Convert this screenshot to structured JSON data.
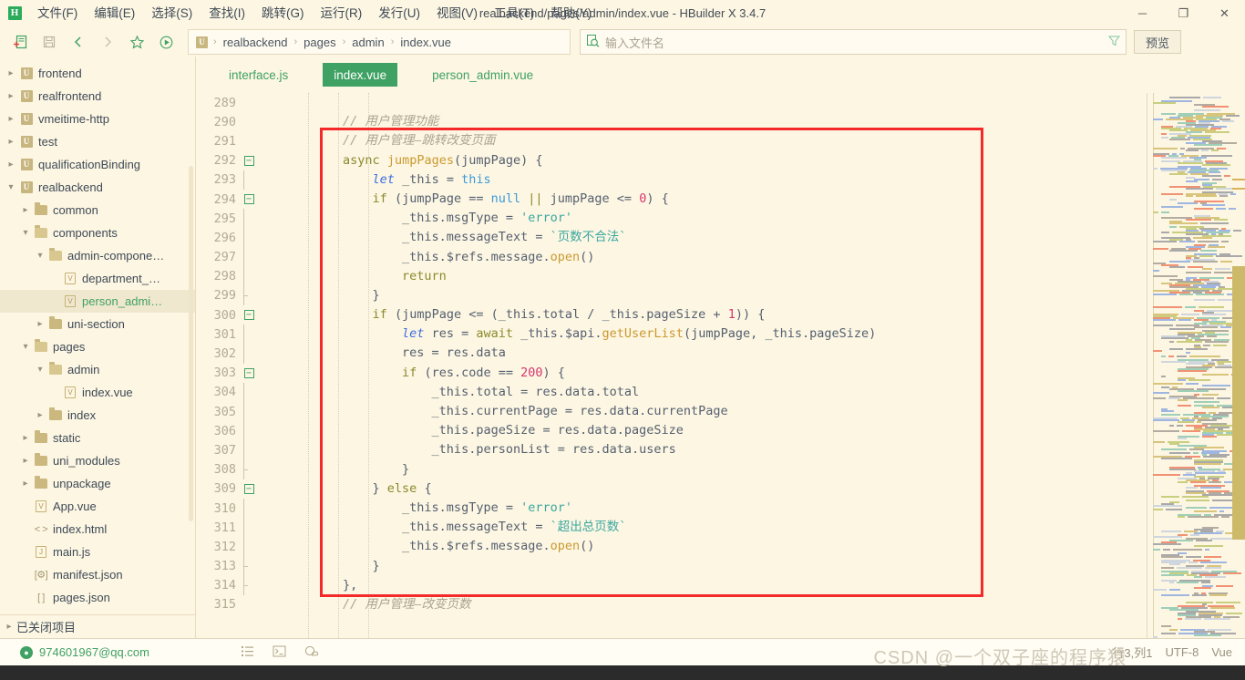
{
  "window": {
    "title": "realbackend/pages/admin/index.vue - HBuilder X 3.4.7",
    "logo": "H",
    "minimize": "─",
    "maximize": "❐",
    "close": "✕"
  },
  "menubar": {
    "items": [
      {
        "label": "文件(F)",
        "name": "menu-file"
      },
      {
        "label": "编辑(E)",
        "name": "menu-edit"
      },
      {
        "label": "选择(S)",
        "name": "menu-select"
      },
      {
        "label": "查找(I)",
        "name": "menu-find"
      },
      {
        "label": "跳转(G)",
        "name": "menu-goto"
      },
      {
        "label": "运行(R)",
        "name": "menu-run"
      },
      {
        "label": "发行(U)",
        "name": "menu-publish"
      },
      {
        "label": "视图(V)",
        "name": "menu-view"
      },
      {
        "label": "工具(T)",
        "name": "menu-tools"
      },
      {
        "label": "帮助(Y)",
        "name": "menu-help"
      }
    ]
  },
  "toolbar": {
    "new_file_icon": "new-file-icon",
    "save_icon": "save-icon",
    "back_icon": "back-arrow-icon",
    "forward_icon": "forward-arrow-icon",
    "favorite_icon": "star-icon",
    "run_icon": "run-play-icon",
    "breadcrumb": {
      "project_badge": "U",
      "items": [
        "realbackend",
        "pages",
        "admin",
        "index.vue"
      ],
      "separator": "›"
    },
    "search": {
      "icon": "file-search-icon",
      "placeholder": "输入文件名",
      "value": "",
      "filter_icon": "filter-icon"
    },
    "preview_label": "预览"
  },
  "sidebar": {
    "tree": [
      {
        "label": "frontend",
        "depth": 0,
        "arrow": "collapsed",
        "icon": "uniapp-project-icon",
        "selected": false
      },
      {
        "label": "realfrontend",
        "depth": 0,
        "arrow": "collapsed",
        "icon": "uniapp-project-icon",
        "selected": false
      },
      {
        "label": "vmeitime-http",
        "depth": 0,
        "arrow": "collapsed",
        "icon": "uniapp-project-icon",
        "selected": false
      },
      {
        "label": "test",
        "depth": 0,
        "arrow": "collapsed",
        "icon": "uniapp-project-icon",
        "selected": false
      },
      {
        "label": "qualificationBinding",
        "depth": 0,
        "arrow": "collapsed",
        "icon": "uniapp-project-icon",
        "selected": false
      },
      {
        "label": "realbackend",
        "depth": 0,
        "arrow": "expanded",
        "icon": "uniapp-project-icon",
        "selected": false
      },
      {
        "label": "common",
        "depth": 1,
        "arrow": "collapsed",
        "icon": "folder-icon",
        "selected": false
      },
      {
        "label": "components",
        "depth": 1,
        "arrow": "expanded",
        "icon": "folder-open-icon",
        "selected": false
      },
      {
        "label": "admin-compone…",
        "depth": 2,
        "arrow": "expanded",
        "icon": "folder-open-icon",
        "selected": false
      },
      {
        "label": "department_…",
        "depth": 3,
        "arrow": "none",
        "icon": "vue-file-icon",
        "selected": false
      },
      {
        "label": "person_admi…",
        "depth": 3,
        "arrow": "none",
        "icon": "vue-file-icon",
        "selected": true
      },
      {
        "label": "uni-section",
        "depth": 2,
        "arrow": "collapsed",
        "icon": "folder-icon",
        "selected": false
      },
      {
        "label": "pages",
        "depth": 1,
        "arrow": "expanded",
        "icon": "folder-open-icon",
        "selected": false
      },
      {
        "label": "admin",
        "depth": 2,
        "arrow": "expanded",
        "icon": "folder-open-icon",
        "selected": false
      },
      {
        "label": "index.vue",
        "depth": 3,
        "arrow": "none",
        "icon": "vue-file-icon",
        "selected": false
      },
      {
        "label": "index",
        "depth": 2,
        "arrow": "collapsed",
        "icon": "folder-icon",
        "selected": false
      },
      {
        "label": "static",
        "depth": 1,
        "arrow": "collapsed",
        "icon": "folder-icon",
        "selected": false
      },
      {
        "label": "uni_modules",
        "depth": 1,
        "arrow": "collapsed",
        "icon": "folder-icon",
        "selected": false
      },
      {
        "label": "unpackage",
        "depth": 1,
        "arrow": "collapsed",
        "icon": "folder-icon",
        "selected": false
      },
      {
        "label": "App.vue",
        "depth": 1,
        "arrow": "none",
        "icon": "vue-file-icon",
        "selected": false
      },
      {
        "label": "index.html",
        "depth": 1,
        "arrow": "none",
        "icon": "html-file-icon",
        "selected": false
      },
      {
        "label": "main.js",
        "depth": 1,
        "arrow": "none",
        "icon": "js-file-icon",
        "selected": false
      },
      {
        "label": "manifest.json",
        "depth": 1,
        "arrow": "none",
        "icon": "manifest-file-icon",
        "selected": false
      },
      {
        "label": "pages.json",
        "depth": 1,
        "arrow": "none",
        "icon": "json-file-icon",
        "selected": false
      }
    ],
    "closed_projects_label": "已关闭项目"
  },
  "tabs": [
    {
      "label": "interface.js",
      "active": false
    },
    {
      "label": "index.vue",
      "active": true
    },
    {
      "label": "person_admin.vue",
      "active": false
    }
  ],
  "editor": {
    "first_line": 289,
    "lines": [
      {
        "num": 289,
        "fold": "none",
        "tokens": []
      },
      {
        "num": 290,
        "fold": "none",
        "tokens": [
          {
            "t": "        ",
            "c": "c-txt"
          },
          {
            "t": "// 用户管理功能",
            "c": "c-com"
          }
        ]
      },
      {
        "num": 291,
        "fold": "none",
        "tokens": [
          {
            "t": "        ",
            "c": "c-txt"
          },
          {
            "t": "// 用户管理—跳转改变页面",
            "c": "c-com"
          }
        ]
      },
      {
        "num": 292,
        "fold": "open",
        "tokens": [
          {
            "t": "        ",
            "c": "c-txt"
          },
          {
            "t": "async",
            "c": "c-kw"
          },
          {
            "t": " ",
            "c": "c-txt"
          },
          {
            "t": "jumpPages",
            "c": "c-fn"
          },
          {
            "t": "(jumpPage) {",
            "c": "c-punc"
          }
        ]
      },
      {
        "num": 293,
        "fold": "bar",
        "tokens": [
          {
            "t": "            ",
            "c": "c-txt"
          },
          {
            "t": "let",
            "c": "c-kw2"
          },
          {
            "t": " _this = ",
            "c": "c-txt"
          },
          {
            "t": "this",
            "c": "c-this"
          }
        ]
      },
      {
        "num": 294,
        "fold": "open",
        "tokens": [
          {
            "t": "            ",
            "c": "c-txt"
          },
          {
            "t": "if",
            "c": "c-kw"
          },
          {
            "t": " (jumpPage == ",
            "c": "c-txt"
          },
          {
            "t": "null",
            "c": "c-this"
          },
          {
            "t": " ",
            "c": "c-txt"
          },
          {
            "t": "||",
            "c": "c-kw"
          },
          {
            "t": " jumpPage <= ",
            "c": "c-txt"
          },
          {
            "t": "0",
            "c": "c-num"
          },
          {
            "t": ") {",
            "c": "c-txt"
          }
        ]
      },
      {
        "num": 295,
        "fold": "bar",
        "tokens": [
          {
            "t": "                _this.msgType = ",
            "c": "c-txt"
          },
          {
            "t": "'error'",
            "c": "c-str"
          }
        ]
      },
      {
        "num": 296,
        "fold": "bar",
        "tokens": [
          {
            "t": "                _this.messageText = ",
            "c": "c-txt"
          },
          {
            "t": "`页数不合法`",
            "c": "c-str"
          }
        ]
      },
      {
        "num": 297,
        "fold": "bar",
        "tokens": [
          {
            "t": "                _this.$refs.message.",
            "c": "c-txt"
          },
          {
            "t": "open",
            "c": "c-fn"
          },
          {
            "t": "()",
            "c": "c-txt"
          }
        ]
      },
      {
        "num": 298,
        "fold": "bar",
        "tokens": [
          {
            "t": "                ",
            "c": "c-txt"
          },
          {
            "t": "return",
            "c": "c-kw"
          }
        ]
      },
      {
        "num": 299,
        "fold": "close",
        "tokens": [
          {
            "t": "            }",
            "c": "c-txt"
          }
        ]
      },
      {
        "num": 300,
        "fold": "open",
        "tokens": [
          {
            "t": "            ",
            "c": "c-txt"
          },
          {
            "t": "if",
            "c": "c-kw"
          },
          {
            "t": " (jumpPage <= (_this.total / _this.pageSize + ",
            "c": "c-txt"
          },
          {
            "t": "1",
            "c": "c-num"
          },
          {
            "t": ")) {",
            "c": "c-txt"
          }
        ]
      },
      {
        "num": 301,
        "fold": "bar",
        "tokens": [
          {
            "t": "                ",
            "c": "c-txt"
          },
          {
            "t": "let",
            "c": "c-kw2"
          },
          {
            "t": " res = ",
            "c": "c-txt"
          },
          {
            "t": "await",
            "c": "c-kw"
          },
          {
            "t": " _this.$api.",
            "c": "c-txt"
          },
          {
            "t": "getUserList",
            "c": "c-fn"
          },
          {
            "t": "(jumpPage, _this.pageSize)",
            "c": "c-txt"
          }
        ]
      },
      {
        "num": 302,
        "fold": "bar",
        "tokens": [
          {
            "t": "                res = res.data",
            "c": "c-txt"
          }
        ]
      },
      {
        "num": 303,
        "fold": "open",
        "tokens": [
          {
            "t": "                ",
            "c": "c-txt"
          },
          {
            "t": "if",
            "c": "c-kw"
          },
          {
            "t": " (res.code == ",
            "c": "c-txt"
          },
          {
            "t": "200",
            "c": "c-num"
          },
          {
            "t": ") {",
            "c": "c-txt"
          }
        ]
      },
      {
        "num": 304,
        "fold": "bar",
        "tokens": [
          {
            "t": "                    _this.total = res.data.total",
            "c": "c-txt"
          }
        ]
      },
      {
        "num": 305,
        "fold": "bar",
        "tokens": [
          {
            "t": "                    _this.currentPage = res.data.currentPage",
            "c": "c-txt"
          }
        ]
      },
      {
        "num": 306,
        "fold": "bar",
        "tokens": [
          {
            "t": "                    _this.pageSize = res.data.pageSize",
            "c": "c-txt"
          }
        ]
      },
      {
        "num": 307,
        "fold": "bar",
        "tokens": [
          {
            "t": "                    _this.personList = res.data.users",
            "c": "c-txt"
          }
        ]
      },
      {
        "num": 308,
        "fold": "close",
        "tokens": [
          {
            "t": "                }",
            "c": "c-txt"
          }
        ]
      },
      {
        "num": 309,
        "fold": "open",
        "tokens": [
          {
            "t": "            } ",
            "c": "c-txt"
          },
          {
            "t": "else",
            "c": "c-kw"
          },
          {
            "t": " {",
            "c": "c-txt"
          }
        ]
      },
      {
        "num": 310,
        "fold": "bar",
        "tokens": [
          {
            "t": "                _this.msgType = ",
            "c": "c-txt"
          },
          {
            "t": "'error'",
            "c": "c-str"
          }
        ]
      },
      {
        "num": 311,
        "fold": "bar",
        "tokens": [
          {
            "t": "                _this.messageText = ",
            "c": "c-txt"
          },
          {
            "t": "`超出总页数`",
            "c": "c-str"
          }
        ]
      },
      {
        "num": 312,
        "fold": "bar",
        "tokens": [
          {
            "t": "                _this.$refs.message.",
            "c": "c-txt"
          },
          {
            "t": "open",
            "c": "c-fn"
          },
          {
            "t": "()",
            "c": "c-txt"
          }
        ]
      },
      {
        "num": 313,
        "fold": "close",
        "tokens": [
          {
            "t": "            }",
            "c": "c-txt"
          }
        ]
      },
      {
        "num": 314,
        "fold": "close",
        "tokens": [
          {
            "t": "        },",
            "c": "c-txt"
          }
        ]
      },
      {
        "num": 315,
        "fold": "none",
        "tokens": [
          {
            "t": "        ",
            "c": "c-txt"
          },
          {
            "t": "// 用户管理—改变页数",
            "c": "c-com"
          }
        ]
      }
    ],
    "highlight_box_color": "#f42a2a"
  },
  "statusbar": {
    "account": "974601967@qq.com",
    "account_icon": "user-circle-icon",
    "list_icon": "outline-list-icon",
    "terminal_icon": "terminal-icon",
    "network_icon": "cloud-plugin-icon",
    "cursor_position": "行3,列1",
    "encoding": "UTF-8",
    "language": "Vue",
    "watermark": "CSDN @一个双子座的程序猿"
  },
  "colors": {
    "background": "#fdf6e3",
    "accent_green": "#3fa163",
    "highlight_red": "#f42a2a",
    "gold": "#c8b681",
    "scrollbar": "#cdb96a"
  }
}
